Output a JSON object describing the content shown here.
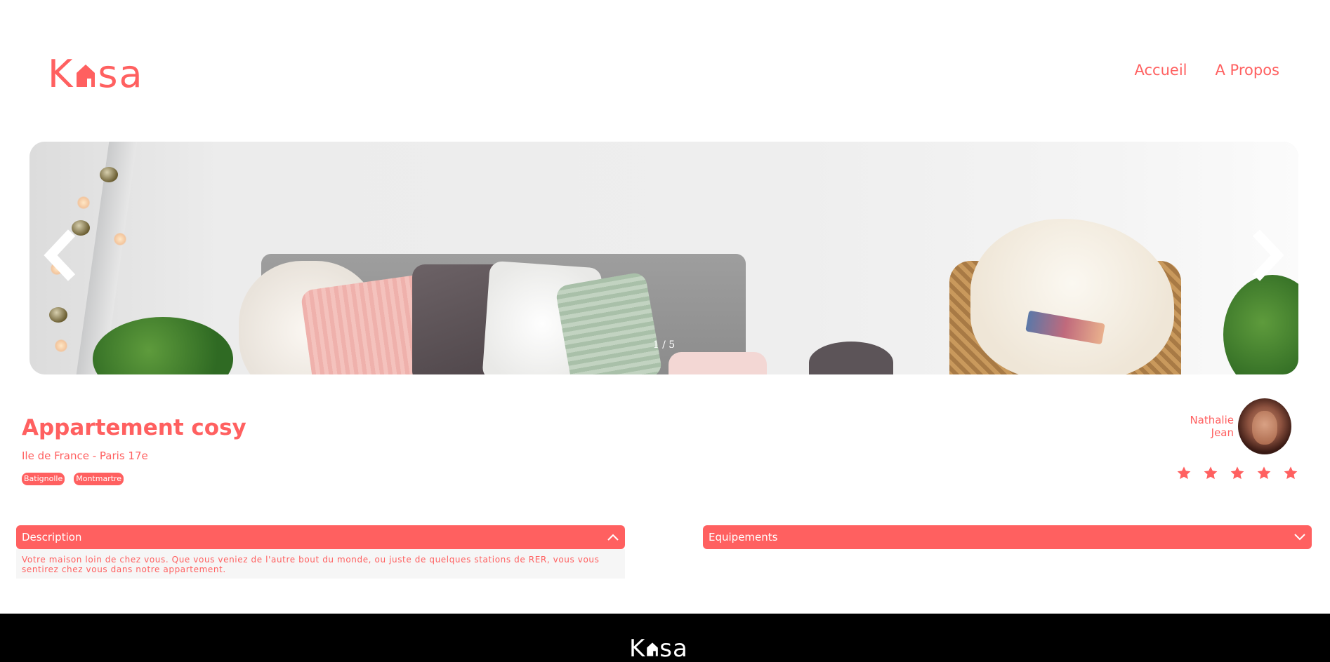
{
  "header": {
    "logo_left": "K",
    "logo_right": "sa",
    "nav": [
      {
        "label": "Accueil"
      },
      {
        "label": "A Propos"
      }
    ]
  },
  "carousel": {
    "counter": "1 / 5",
    "prev_icon": "chevron-left-icon",
    "next_icon": "chevron-right-icon"
  },
  "listing": {
    "title": "Appartement cosy",
    "location": "Ile de France - Paris 17e",
    "tags": [
      "Batignolle",
      "Montmartre"
    ],
    "host": {
      "first_name": "Nathalie",
      "last_name": "Jean"
    },
    "rating": {
      "value": 5,
      "max": 5
    }
  },
  "collapses": {
    "description": {
      "label": "Description",
      "expanded": true,
      "content": "Votre maison loin de chez vous. Que vous veniez de l'autre bout du monde, ou juste de quelques stations de RER, vous vous sentirez chez vous dans notre appartement."
    },
    "equipments": {
      "label": "Equipements",
      "expanded": false
    }
  },
  "footer": {
    "logo_left": "K",
    "logo_right": "sa"
  },
  "colors": {
    "accent": "#FF6060",
    "footer_bg": "#000000",
    "collapse_bg": "#F6F6F6"
  }
}
